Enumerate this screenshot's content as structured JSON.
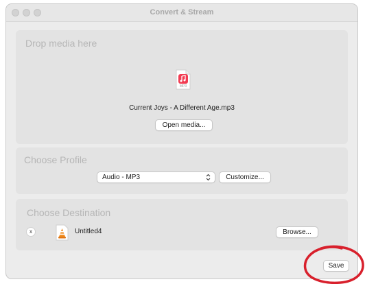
{
  "window": {
    "title": "Convert & Stream"
  },
  "drop_panel": {
    "title": "Drop media here",
    "file_icon_label": "MP3",
    "file_name": "Current Joys - A Different Age.mp3",
    "open_button": "Open media..."
  },
  "profile_panel": {
    "title": "Choose Profile",
    "selected_profile": "Audio - MP3",
    "customize_button": "Customize..."
  },
  "destination_panel": {
    "title": "Choose Destination",
    "remove_label": "x",
    "destination_name": "Untitled4",
    "browse_button": "Browse..."
  },
  "footer": {
    "save_button": "Save"
  },
  "colors": {
    "music_icon": "#f23c52",
    "vlc_cone": "#f08a1c",
    "annotation_circle": "#d8202c"
  },
  "icons": [
    "music-note-icon",
    "vlc-cone-icon",
    "updown-chevron-icon",
    "close-icon"
  ]
}
